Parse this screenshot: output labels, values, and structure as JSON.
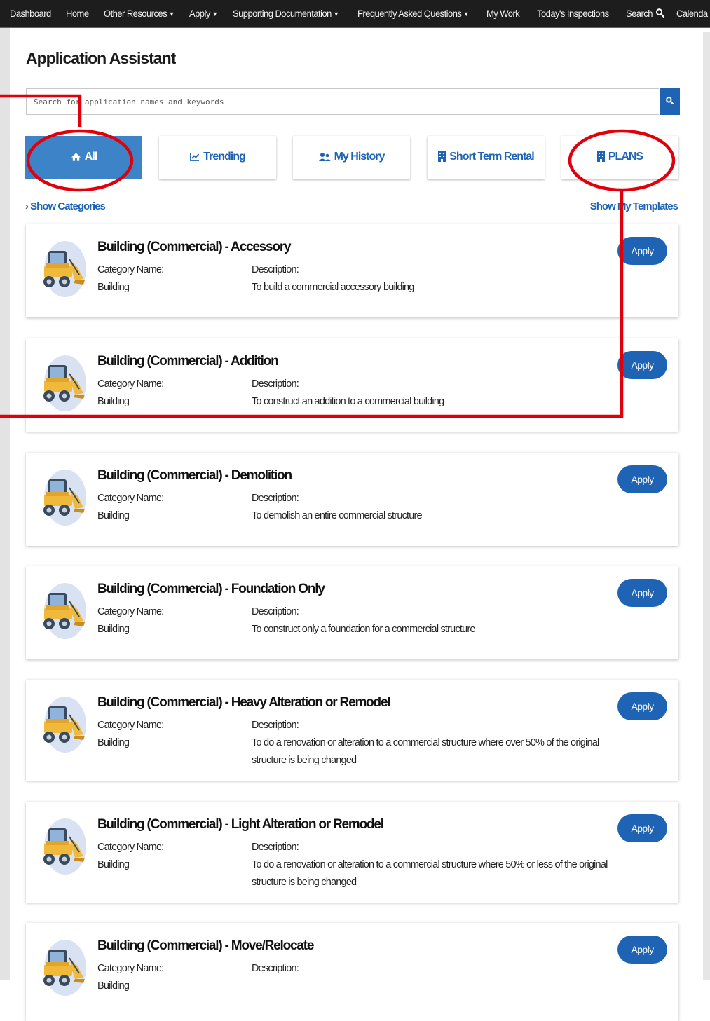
{
  "nav": {
    "items": [
      {
        "label": "Dashboard",
        "dropdown": false
      },
      {
        "label": "Home",
        "dropdown": false
      },
      {
        "label": "Other Resources",
        "dropdown": true
      },
      {
        "label": "Apply",
        "dropdown": true
      },
      {
        "label": "Supporting Documentation",
        "dropdown": true
      },
      {
        "label": "Frequently Asked Questions",
        "dropdown": true
      },
      {
        "label": "My Work",
        "dropdown": false
      },
      {
        "label": "Today's Inspections",
        "dropdown": false
      },
      {
        "label": "Search",
        "dropdown": false
      },
      {
        "label": "Calenda",
        "dropdown": false
      }
    ]
  },
  "page": {
    "title": "Application Assistant"
  },
  "search": {
    "placeholder": "Search for application names and keywords",
    "value": ""
  },
  "tabs": [
    {
      "label": "All",
      "icon": "home-icon",
      "active": true
    },
    {
      "label": "Trending",
      "icon": "chart-icon",
      "active": false
    },
    {
      "label": "My History",
      "icon": "users-icon",
      "active": false
    },
    {
      "label": "Short Term Rental",
      "icon": "building-icon",
      "active": false
    },
    {
      "label": "PLANS",
      "icon": "building-icon",
      "active": false
    }
  ],
  "links": {
    "show_categories": "Show Categories",
    "show_templates": "Show My Templates"
  },
  "card_labels": {
    "category": "Category Name:",
    "description": "Description:",
    "apply": "Apply"
  },
  "cards": [
    {
      "title": "Building (Commercial) - Accessory",
      "category": "Building",
      "description": "To build a commercial accessory building"
    },
    {
      "title": "Building (Commercial) - Addition",
      "category": "Building",
      "description": "To construct an addition to a commercial building"
    },
    {
      "title": "Building (Commercial) - Demolition",
      "category": "Building",
      "description": "To demolish an entire commercial structure"
    },
    {
      "title": "Building (Commercial) - Foundation Only",
      "category": "Building",
      "description": "To construct only a foundation for a commercial structure"
    },
    {
      "title": "Building (Commercial) - Heavy Alteration or Remodel",
      "category": "Building",
      "description": "To do a renovation or alteration to a commercial structure where over 50% of the original structure is being changed"
    },
    {
      "title": "Building (Commercial) - Light Alteration or Remodel",
      "category": "Building",
      "description": "To do a renovation or alteration to a commercial structure where 50% or less of the original structure is being changed"
    },
    {
      "title": "Building (Commercial) - Move/Relocate",
      "category": "Building",
      "description": ""
    }
  ],
  "colors": {
    "nav_bg": "#1d1d1d",
    "primary_blue": "#1f63b5",
    "active_tab": "#3d83c7",
    "annotation_red": "#e0000b"
  }
}
